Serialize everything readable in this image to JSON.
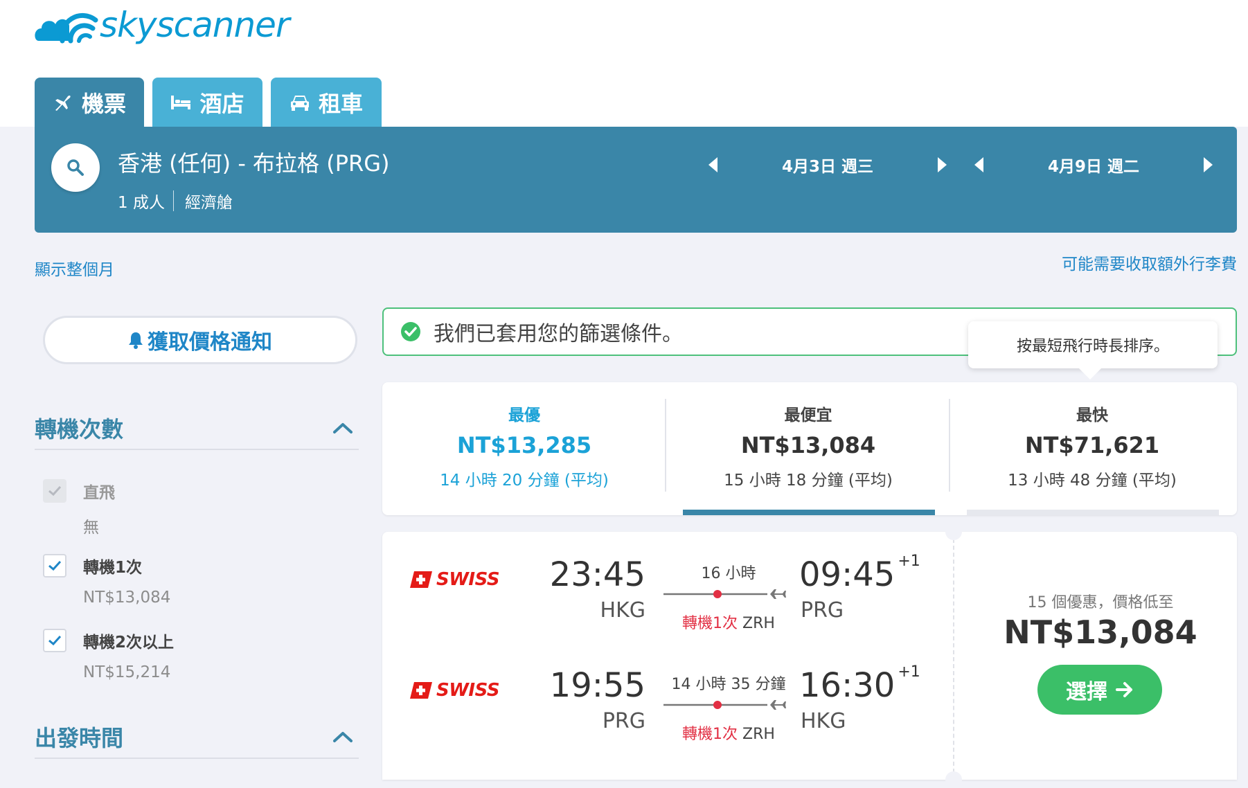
{
  "brand": {
    "name": "skyscanner",
    "color": "#0b9ad3"
  },
  "tabs": [
    {
      "label": "機票",
      "icon": "plane-icon",
      "active": true
    },
    {
      "label": "酒店",
      "icon": "bed-icon",
      "active": false
    },
    {
      "label": "租車",
      "icon": "car-icon",
      "active": false
    }
  ],
  "search": {
    "route": "香港 (任何) - 布拉格 (PRG)",
    "passengers": "1 成人",
    "cabin": "經濟艙",
    "outbound_date": "4月3日 週三",
    "return_date": "4月9日 週二"
  },
  "links": {
    "show_month": "顯示整個月",
    "baggage_fees": "可能需要收取額外行李費"
  },
  "sidebar": {
    "price_alert": "獲取價格通知",
    "stops_title": "轉機次數",
    "stop_options": [
      {
        "label": "直飛",
        "sub": "無",
        "checked": true,
        "disabled": true
      },
      {
        "label": "轉機1次",
        "sub": "NT$13,084",
        "checked": true,
        "disabled": false
      },
      {
        "label": "轉機2次以上",
        "sub": "NT$15,214",
        "checked": true,
        "disabled": false
      }
    ],
    "departure_title": "出發時間"
  },
  "notice": {
    "text": "我們已套用您的篩選條件。"
  },
  "tooltip": {
    "text": "按最短飛行時長排序。"
  },
  "sort_tabs": [
    {
      "label": "最優",
      "price": "NT$13,285",
      "duration": "14 小時 20 分鐘 (平均)"
    },
    {
      "label": "最便宜",
      "price": "NT$13,084",
      "duration": "15 小時 18 分鐘 (平均)"
    },
    {
      "label": "最快",
      "price": "NT$71,621",
      "duration": "13 小時 48 分鐘 (平均)"
    }
  ],
  "result": {
    "legs": [
      {
        "airline": "SWISS",
        "depart_time": "23:45",
        "depart_airport": "HKG",
        "duration": "16 小時",
        "stops": "轉機1次",
        "via": "ZRH",
        "arrive_time": "09:45",
        "day_offset": "+1",
        "arrive_airport": "PRG"
      },
      {
        "airline": "SWISS",
        "depart_time": "19:55",
        "depart_airport": "PRG",
        "duration": "14 小時 35 分鐘",
        "stops": "轉機1次",
        "via": "ZRH",
        "arrive_time": "16:30",
        "day_offset": "+1",
        "arrive_airport": "HKG"
      }
    ],
    "deals": "15 個優惠，價格低至",
    "price": "NT$13,084",
    "select_label": "選擇"
  },
  "colors": {
    "primary": "#3a86a8",
    "tab": "#49b1d6",
    "link": "#1f86c7",
    "green": "#3bbf68",
    "red": "#e22f43"
  }
}
